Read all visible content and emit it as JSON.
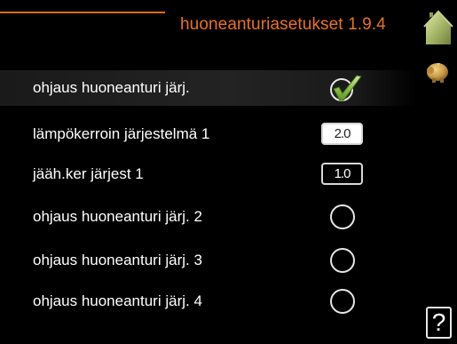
{
  "header": {
    "title": "huoneanturiasetukset 1.9.4",
    "accent_color": "#e8731f",
    "home_icon": "home-icon",
    "side_icon": "piggy-bank-icon"
  },
  "settings": [
    {
      "label": "ohjaus huoneanturi järj.",
      "control": "checkbox",
      "checked": true
    },
    {
      "label": "lämpökerroin järjestelmä 1",
      "control": "value",
      "value": "2.0"
    },
    {
      "label": "jääh.ker järjest 1",
      "control": "value",
      "value": "1.0"
    },
    {
      "label": "ohjaus huoneanturi järj. 2",
      "control": "radio",
      "checked": false
    },
    {
      "label": "ohjaus huoneanturi järj. 3",
      "control": "radio",
      "checked": false
    },
    {
      "label": "ohjaus huoneanturi järj. 4",
      "control": "radio",
      "checked": false
    }
  ],
  "help": {
    "symbol": "?"
  }
}
